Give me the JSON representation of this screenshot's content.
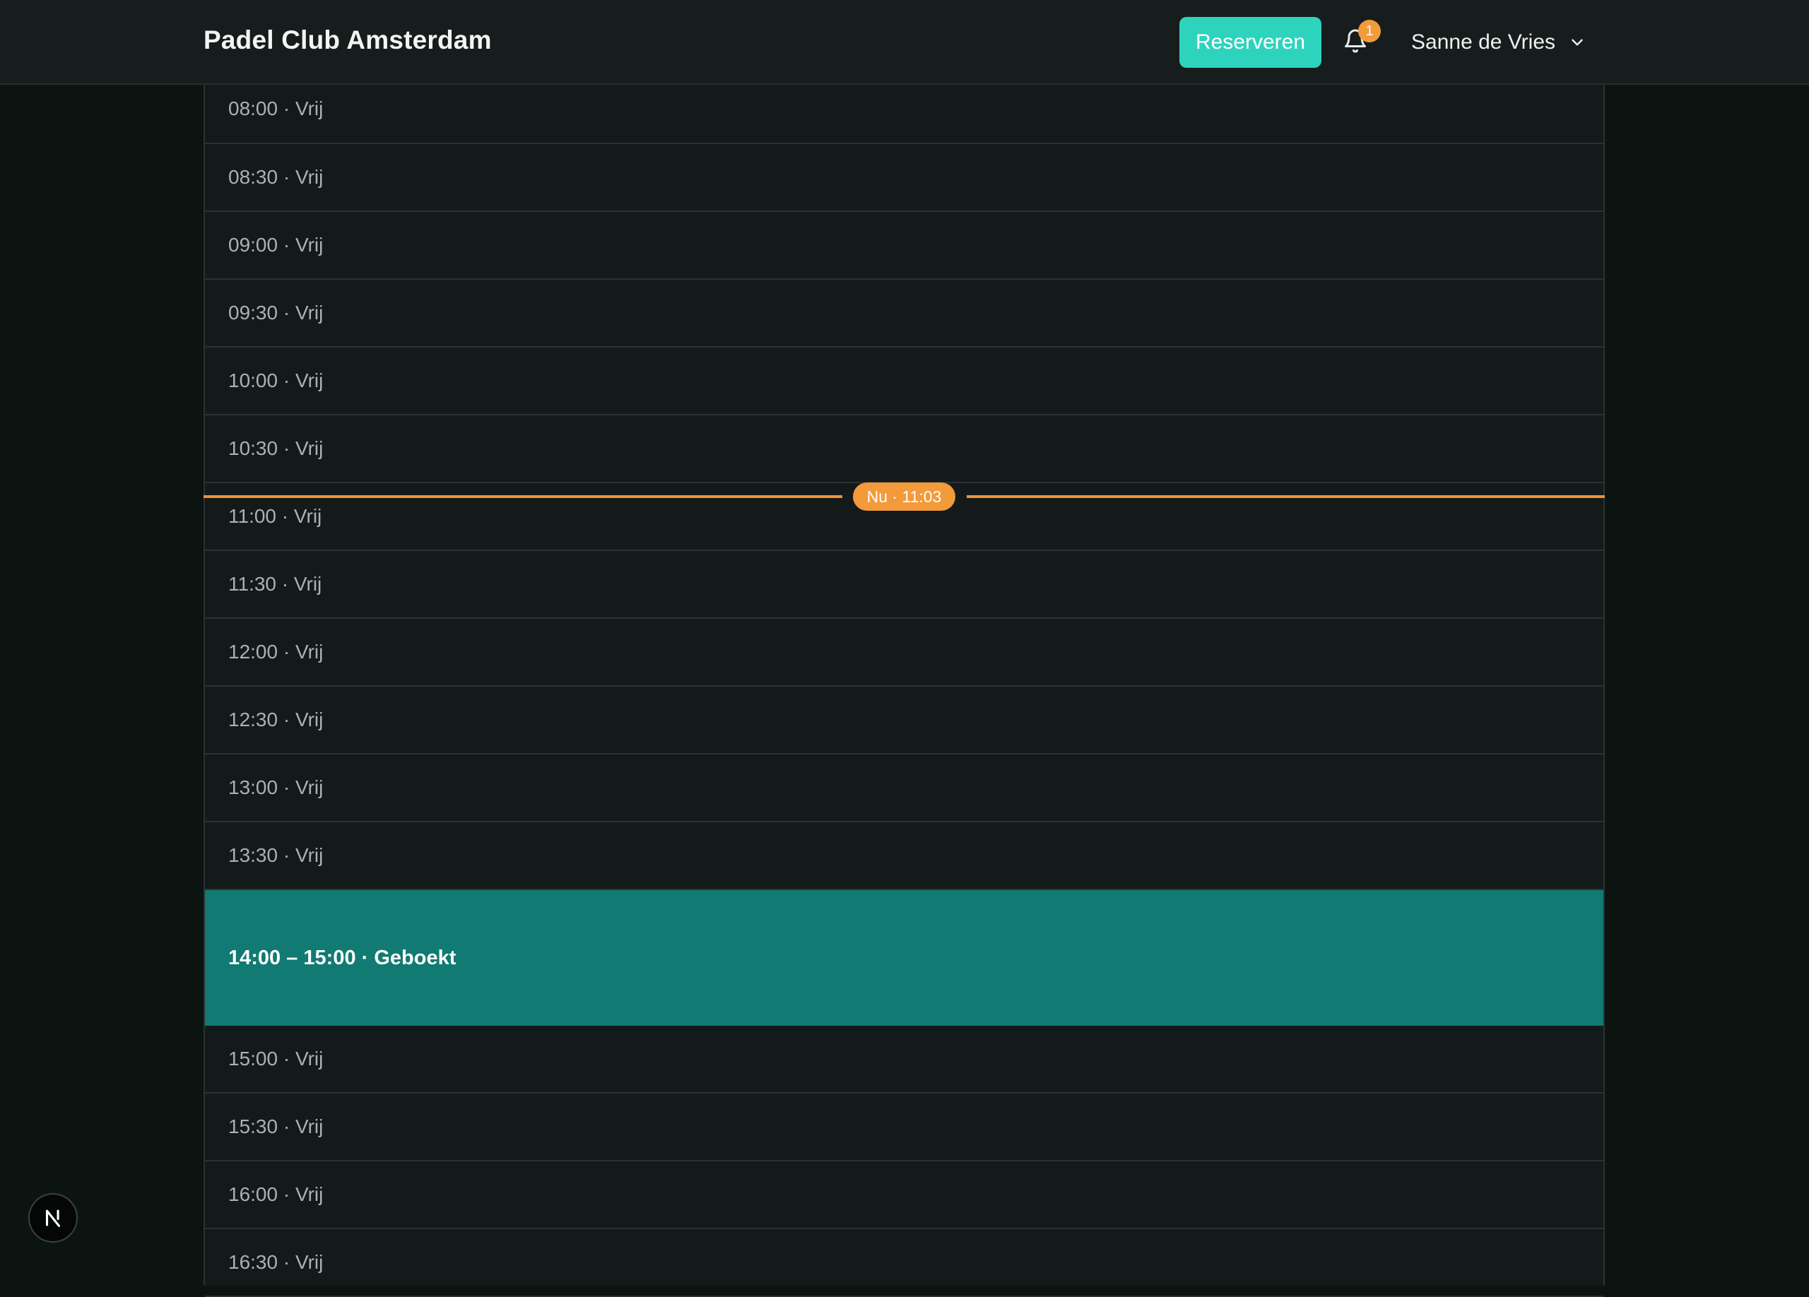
{
  "header": {
    "brand": "Padel Club Amsterdam",
    "reserve_label": "Reserveren",
    "notification_count": "1",
    "user_name": "Sanne de Vries"
  },
  "now_indicator": {
    "label": "Nu · 11:03"
  },
  "slots": [
    "08:00 · Vrij",
    "08:30 · Vrij",
    "09:00 · Vrij",
    "09:30 · Vrij",
    "10:00 · Vrij",
    "10:30 · Vrij",
    "11:00 · Vrij",
    "11:30 · Vrij",
    "12:00 · Vrij",
    "12:30 · Vrij",
    "13:00 · Vrij",
    "13:30 · Vrij"
  ],
  "booking": {
    "label": "14:00 – 15:00 · Geboekt"
  },
  "slots_after": [
    "15:00 · Vrij",
    "15:30 · Vrij",
    "16:00 · Vrij",
    "16:30 · Vrij"
  ],
  "colors": {
    "accent": "#2ed3bd",
    "booked": "#117a72",
    "now": "#f39a3a"
  },
  "icons": {
    "bell": "bell-icon",
    "chevron": "chevron-down-icon",
    "fab": "next-logo-icon"
  }
}
